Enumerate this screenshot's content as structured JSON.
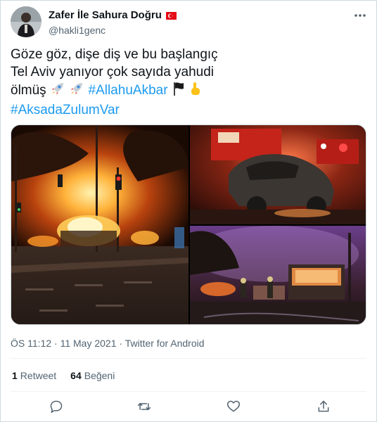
{
  "tweet": {
    "display_name": "Zafer İle Sahura Doğru",
    "handle": "@hakli1genc",
    "flag": "turkey-flag-icon",
    "text_line1": "Göze göz, dişe diş ve bu başlangıç",
    "text_line2": "Tel Aviv yanıyor çok sayıda yahudi",
    "text_line3_prefix": "ölmüş",
    "hashtag1": "#AllahuAkbar",
    "hashtag2": "#AksadaZulumVar",
    "emojis": [
      "rocket-icon",
      "rocket-icon",
      "black-flag-icon",
      "pointing-up-icon"
    ],
    "time": "ÖS 11:12",
    "separator": "·",
    "date": "11 May 2021",
    "source": "Twitter for Android",
    "retweet_count": "1",
    "retweet_label": "Retweet",
    "like_count": "64",
    "like_label": "Beğeni"
  },
  "media": {
    "photo_count": 3,
    "descriptions": [
      "burning-bus-street-at-night",
      "burned-car-with-fire-trucks",
      "burning-bus-with-firefighters"
    ]
  },
  "actions": [
    "reply-icon",
    "retweet-icon",
    "like-icon",
    "share-icon"
  ],
  "colors": {
    "text": "#0f1419",
    "secondary": "#536471",
    "link": "#1d9bf0",
    "border": "#cfd9de"
  }
}
